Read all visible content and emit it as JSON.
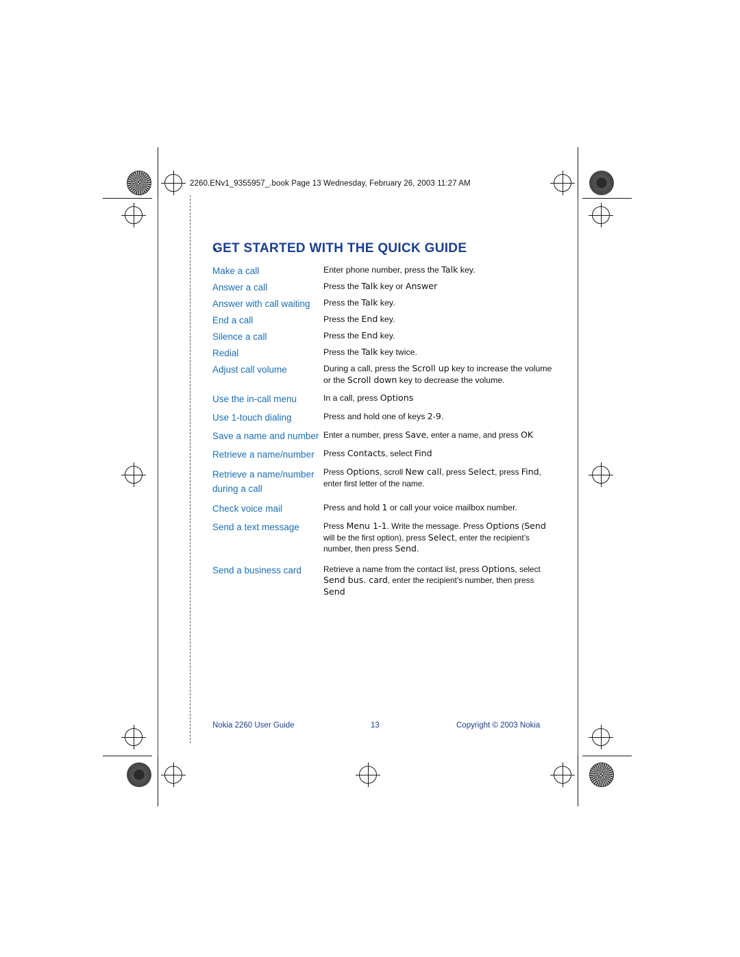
{
  "document": {
    "file_stamp": "2260.ENv1_9355957_.book  Page 13  Wednesday, February 26, 2003  11:27 AM",
    "title": "GET STARTED WITH THE QUICK GUIDE",
    "accent_color": "#1b3f8f",
    "label_color": "#1b6fb5",
    "rows": [
      {
        "label": "Make a call",
        "desc": "Enter phone number, press the Talk key."
      },
      {
        "label": "Answer a call",
        "desc": "Press the Talk key or Answer"
      },
      {
        "label": "Answer with call waiting",
        "desc": "Press the Talk key."
      },
      {
        "label": "End a call",
        "desc": "Press the End key."
      },
      {
        "label": "Silence a call",
        "desc": "Press the End key."
      },
      {
        "label": "Redial",
        "desc": "Press the Talk key twice."
      },
      {
        "label": "Adjust call volume",
        "desc": "During a call, press the Scroll up key to increase the volume or the Scroll down key to decrease the volume."
      },
      {
        "label": "Use the in-call menu",
        "desc": "In a call, press Options"
      },
      {
        "label": "Use 1-touch dialing",
        "desc": "Press and hold one of keys 2-9."
      },
      {
        "label": "Save a name and number",
        "desc": "Enter a number, press Save, enter a name, and press OK"
      },
      {
        "label": "Retrieve a name/number",
        "desc": "Press Contacts, select Find"
      },
      {
        "label": "Retrieve a name/number during a call",
        "desc": "Press Options, scroll New call, press Select, press Find, enter first letter of the name."
      },
      {
        "label": "Check voice mail",
        "desc": "Press and hold 1 or call your voice mailbox number."
      },
      {
        "label": "Send a text message",
        "desc": "Press Menu 1-1. Write the message. Press Options (Send will be the first option), press Select, enter the recipient’s number, then press Send."
      },
      {
        "label": "Send a business card",
        "desc": "Retrieve a name from the contact list, press Options, select Send bus. card, enter the recipient’s number, then press Send"
      }
    ],
    "footer": {
      "left": "Nokia 2260 User Guide",
      "page_number": "13",
      "right": "Copyright © 2003 Nokia"
    }
  }
}
